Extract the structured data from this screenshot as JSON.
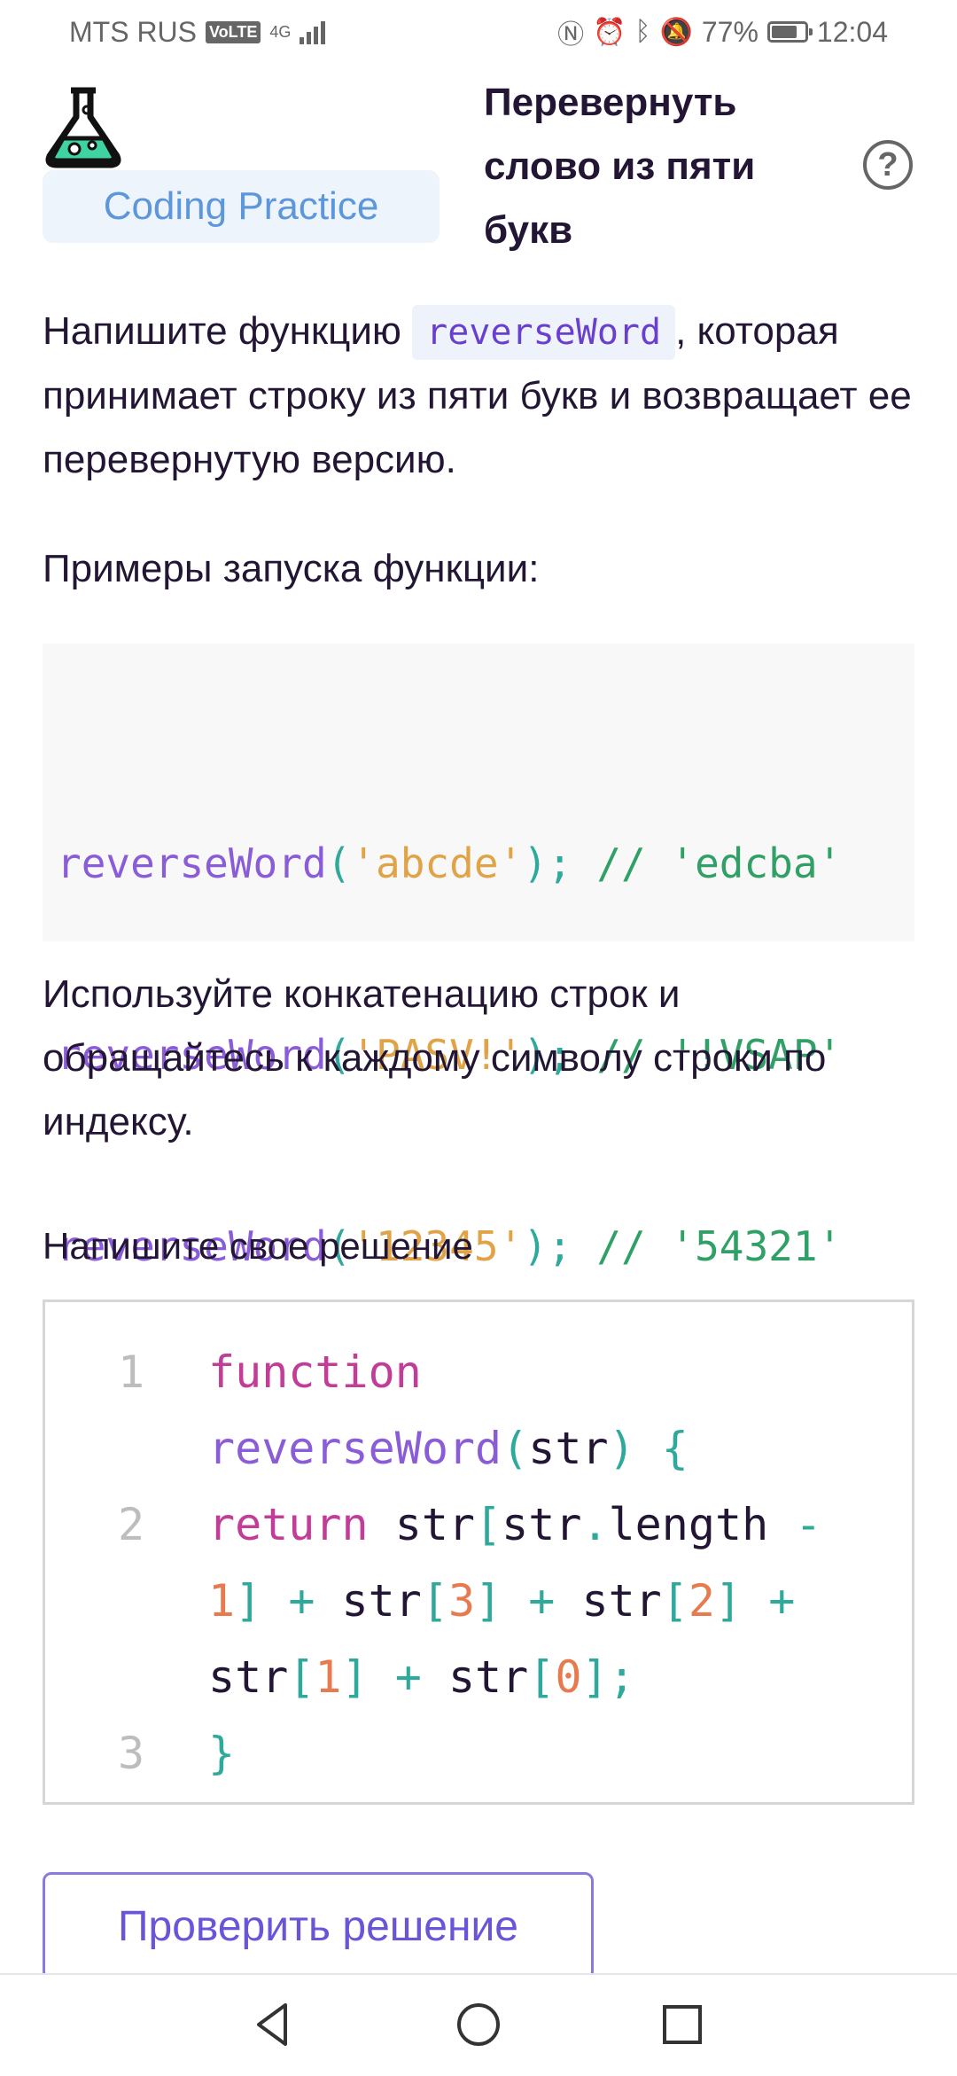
{
  "status": {
    "carrier": "MTS RUS",
    "volte": "VoLTE",
    "network": "4G",
    "battery": "77%",
    "battery_level": 0.77,
    "time": "12:04"
  },
  "header": {
    "chip_label": "Coding Practice",
    "title": "Перевернуть слово из пяти букв",
    "help_label": "?"
  },
  "task": {
    "intro_before": "Напишите функцию",
    "function_name": "reverseWord",
    "intro_after": ", которая принимает строку из пяти букв и возвращает ее перевернутую версию.",
    "examples_label": "Примеры запуска функции:",
    "examples": [
      {
        "fn": "reverseWord",
        "arg": "'abcde'",
        "result": "// 'edcba'"
      },
      {
        "fn": "reverseWord",
        "arg": "'PASV!'",
        "result": "// '!VSAP'"
      },
      {
        "fn": "reverseWord",
        "arg": "'12345'",
        "result": "// '54321'"
      }
    ],
    "hint": "Используйте конкатенацию строк и обращайтесь к каждому символу строки по индексу."
  },
  "editor": {
    "label": "Напишите свое решение",
    "line_numbers": [
      "1",
      "2",
      "3"
    ],
    "code_lines": [
      "function",
      "reverseWord(str) {",
      "return str[str.length -",
      "1] + str[3] + str[2] +",
      "str[1] + str[0];",
      "}"
    ]
  },
  "actions": {
    "check_label": "Проверить решение"
  },
  "colors": {
    "text": "#231634",
    "chip_bg": "#eef4fb",
    "chip_text": "#5c97dc",
    "button_border": "#8a7ae0",
    "keyword": "#c13d97",
    "function": "#8a5cd8",
    "string": "#e0a347",
    "comment": "#30a067",
    "number": "#e87a50"
  }
}
